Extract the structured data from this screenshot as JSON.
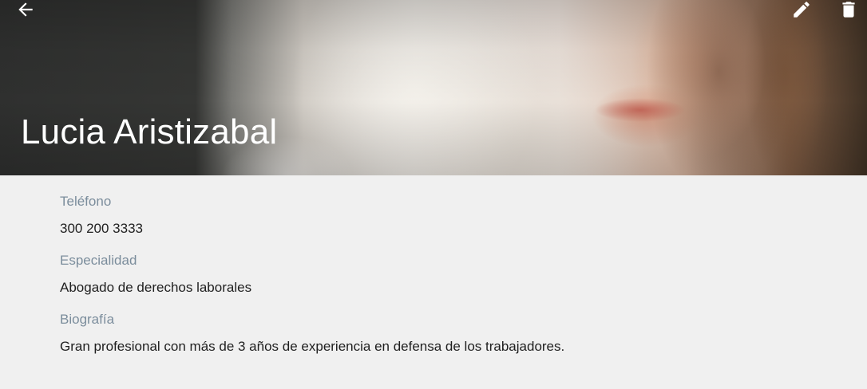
{
  "header": {
    "name": "Lucia Aristizabal",
    "back_icon": "arrow-left-icon",
    "edit_icon": "pencil-icon",
    "delete_icon": "trash-icon"
  },
  "details": {
    "phone_label": "Teléfono",
    "phone_value": "300 200 3333",
    "specialty_label": "Especialidad",
    "specialty_value": "Abogado de derechos laborales",
    "bio_label": "Biografía",
    "bio_value": "Gran profesional con más de 3 años de experiencia en defensa de los trabajadores."
  },
  "colors": {
    "page_background": "#f0f0f0",
    "label_text": "#7b8d9c",
    "value_text": "#1f1f1f",
    "header_text": "#ffffff"
  }
}
